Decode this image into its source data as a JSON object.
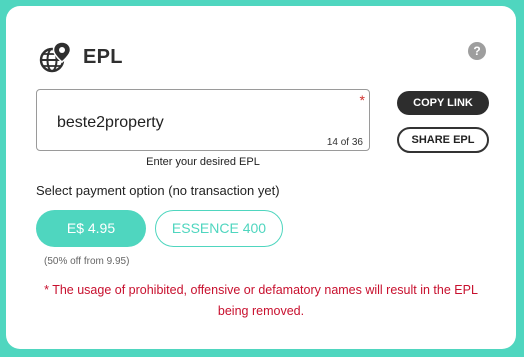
{
  "header": {
    "title": "EPL",
    "icon": "globe-location-icon",
    "help_icon": "?"
  },
  "epl_input": {
    "value": "beste2property",
    "required_marker": "*",
    "counter": "14 of 36",
    "hint": "Enter your desired EPL"
  },
  "actions": {
    "copy_label": "COPY LINK",
    "share_label": "SHARE EPL"
  },
  "payment": {
    "label": "Select payment option (no transaction yet)",
    "price_label": "E$ 4.95",
    "essence_label": "ESSENCE 400",
    "discount_note": "(50% off from 9.95)"
  },
  "warning": "* The usage of prohibited, offensive or defamatory names will result in the EPL being removed.",
  "colors": {
    "accent": "#4fd6bf",
    "dark": "#2d2d2d",
    "warning": "#c8102e"
  }
}
